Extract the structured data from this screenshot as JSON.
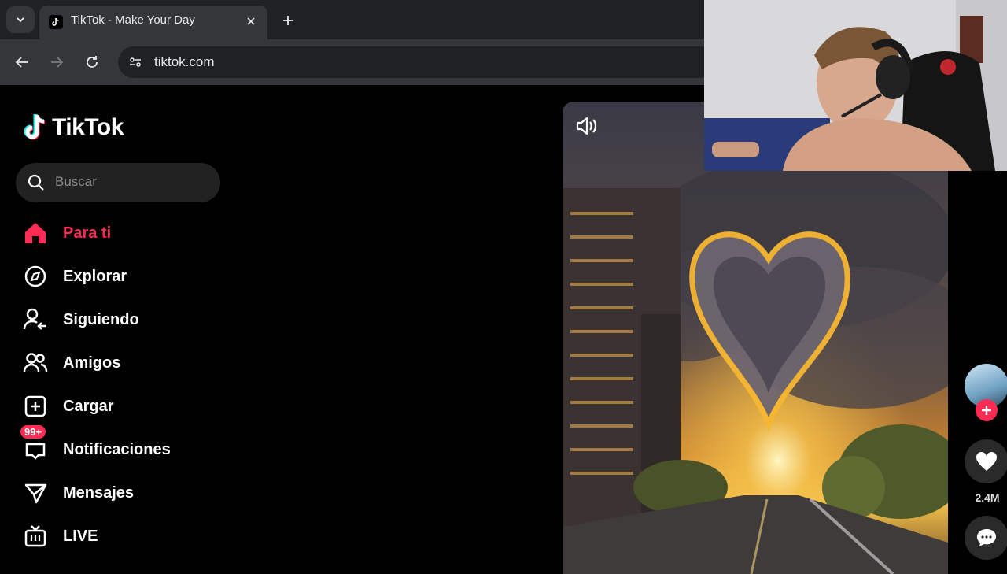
{
  "browser": {
    "tab_title": "TikTok - Make Your Day",
    "url": "tiktok.com"
  },
  "app": {
    "logo_text": "TikTok",
    "search_placeholder": "Buscar",
    "menu": [
      {
        "label": "Para ti",
        "icon": "home-icon",
        "active": true
      },
      {
        "label": "Explorar",
        "icon": "compass-icon"
      },
      {
        "label": "Siguiendo",
        "icon": "following-icon"
      },
      {
        "label": "Amigos",
        "icon": "friends-icon"
      },
      {
        "label": "Cargar",
        "icon": "upload-icon"
      },
      {
        "label": "Notificaciones",
        "icon": "inbox-icon",
        "badge": "99+"
      },
      {
        "label": "Mensajes",
        "icon": "send-icon"
      },
      {
        "label": "LIVE",
        "icon": "live-tv-icon"
      }
    ]
  },
  "video": {
    "likes": "2.4M"
  },
  "colors": {
    "accent": "#fe2c55",
    "sidebar_bg": "#000000",
    "chrome_dark": "#202124",
    "chrome_toolbar": "#35363a"
  }
}
